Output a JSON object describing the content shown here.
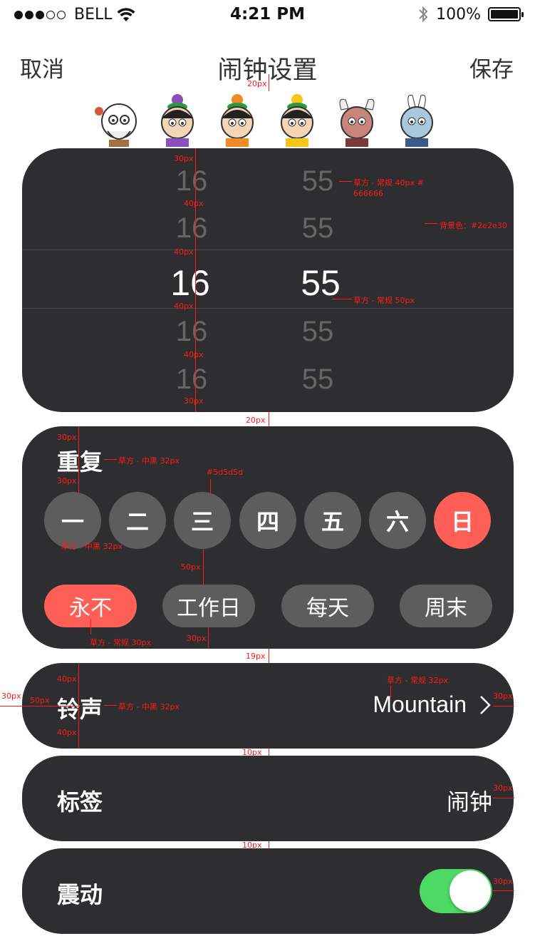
{
  "status_bar": {
    "carrier": "BELL",
    "time": "4:21 PM",
    "battery": "100%",
    "signal_bars_filled": 3,
    "signal_bars_total": 5
  },
  "nav": {
    "cancel": "取消",
    "title": "闹钟设置",
    "save": "保存"
  },
  "picker": {
    "hours": [
      "16",
      "16",
      "16",
      "16",
      "16"
    ],
    "minutes": [
      "55",
      "55",
      "55",
      "55",
      "55"
    ],
    "selected_index": 2
  },
  "repeat": {
    "label": "重复",
    "days": [
      {
        "label": "一",
        "selected": false
      },
      {
        "label": "二",
        "selected": false
      },
      {
        "label": "三",
        "selected": false
      },
      {
        "label": "四",
        "selected": false
      },
      {
        "label": "五",
        "selected": false
      },
      {
        "label": "六",
        "selected": false
      },
      {
        "label": "日",
        "selected": true
      }
    ],
    "presets": [
      {
        "label": "永不",
        "selected": true
      },
      {
        "label": "工作日",
        "selected": false
      },
      {
        "label": "每天",
        "selected": false
      },
      {
        "label": "周末",
        "selected": false
      }
    ]
  },
  "ringtone": {
    "label": "铃声",
    "value": "Mountain"
  },
  "tag": {
    "label": "标签",
    "value": "闹钟"
  },
  "vibrate": {
    "label": "震动",
    "on": true
  },
  "colors": {
    "card_bg": "#2e2e30",
    "inactive_day": "#5d5d5d",
    "accent": "#ff5f57",
    "toggle_on": "#4cd964",
    "dim_text": "#666666"
  },
  "annotations": {
    "a1": "20px",
    "a2": "30px",
    "a3": "草方 - 常规 40px  #",
    "a3b": "666666",
    "a4": "40px",
    "a5": "背景色：#2e2e30",
    "a6": "40px",
    "a7": "草方 - 常规 50px",
    "a8": "40px",
    "a9": "40px",
    "a10": "30px",
    "a11": "20px",
    "a12": "30px",
    "a13": "草方 - 中黑 32px",
    "a14": "#5d5d5d",
    "a15": "30px",
    "a16": "草方 - 中黑 32px",
    "a17": "50px",
    "a18": "草方 - 常规 30px",
    "a19": "30px",
    "a20": "19px",
    "a21": "40px",
    "a22": "草方 - 常规 32px",
    "a23": "30px",
    "a24": "50px",
    "a25": "草方 - 中黑 32px",
    "a26": "30px",
    "a27": "40px",
    "a28": "10px",
    "a29": "30px",
    "a30": "10px",
    "a31": "30px"
  }
}
